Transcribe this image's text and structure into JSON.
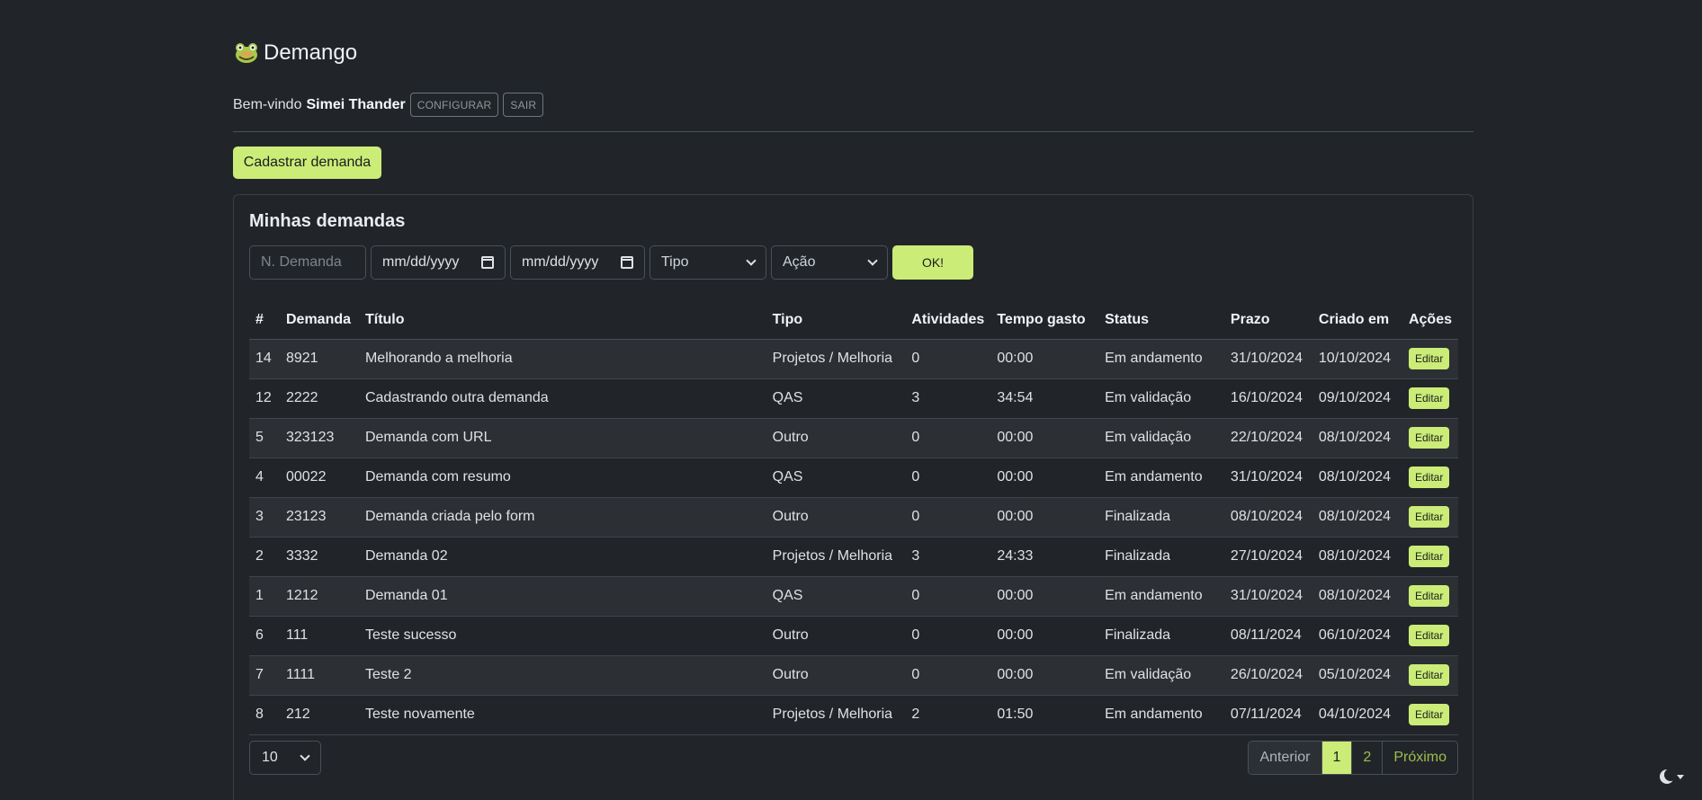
{
  "app": {
    "name": "Demango",
    "logo_icon": "frog-face-icon"
  },
  "user": {
    "welcome": "Bem-vindo",
    "name": "Simei Thander",
    "configure_label": "CONFIGURAR",
    "logout_label": "SAIR"
  },
  "actions": {
    "create_label": "Cadastrar demanda"
  },
  "card": {
    "title": "Minhas demandas"
  },
  "filters": {
    "demand_placeholder": "N. Demanda",
    "date_from": "mm/dd/yyyy",
    "date_to": "mm/dd/yyyy",
    "type_selected": "Tipo",
    "action_selected": "Ação",
    "ok_label": "OK!"
  },
  "table": {
    "headers": [
      "#",
      "Demanda",
      "Título",
      "Tipo",
      "Atividades",
      "Tempo gasto",
      "Status",
      "Prazo",
      "Criado em",
      "Ações"
    ],
    "edit_label": "Editar",
    "rows": [
      [
        "14",
        "8921",
        "Melhorando a melhoria",
        "Projetos / Melhoria",
        "0",
        "00:00",
        "Em andamento",
        "31/10/2024",
        "10/10/2024"
      ],
      [
        "12",
        "2222",
        "Cadastrando outra demanda",
        "QAS",
        "3",
        "34:54",
        "Em validação",
        "16/10/2024",
        "09/10/2024"
      ],
      [
        "5",
        "323123",
        "Demanda com URL",
        "Outro",
        "0",
        "00:00",
        "Em validação",
        "22/10/2024",
        "08/10/2024"
      ],
      [
        "4",
        "00022",
        "Demanda com resumo",
        "QAS",
        "0",
        "00:00",
        "Em andamento",
        "31/10/2024",
        "08/10/2024"
      ],
      [
        "3",
        "23123",
        "Demanda criada pelo form",
        "Outro",
        "0",
        "00:00",
        "Finalizada",
        "08/10/2024",
        "08/10/2024"
      ],
      [
        "2",
        "3332",
        "Demanda 02",
        "Projetos / Melhoria",
        "3",
        "24:33",
        "Finalizada",
        "27/10/2024",
        "08/10/2024"
      ],
      [
        "1",
        "1212",
        "Demanda 01",
        "QAS",
        "0",
        "00:00",
        "Em andamento",
        "31/10/2024",
        "08/10/2024"
      ],
      [
        "6",
        "111",
        "Teste sucesso",
        "Outro",
        "0",
        "00:00",
        "Finalizada",
        "08/11/2024",
        "06/10/2024"
      ],
      [
        "7",
        "1111",
        "Teste 2",
        "Outro",
        "0",
        "00:00",
        "Em validação",
        "26/10/2024",
        "05/10/2024"
      ],
      [
        "8",
        "212",
        "Teste novamente",
        "Projetos / Melhoria",
        "2",
        "01:50",
        "Em andamento",
        "07/11/2024",
        "04/10/2024"
      ]
    ]
  },
  "pagination": {
    "page_size": "10",
    "prev": "Anterior",
    "pages": [
      "1",
      "2"
    ],
    "active_page": "1",
    "next": "Próximo"
  },
  "theme": {
    "icon": "moon-icon"
  },
  "colors": {
    "accent": "#cbec77",
    "background": "#212529"
  }
}
